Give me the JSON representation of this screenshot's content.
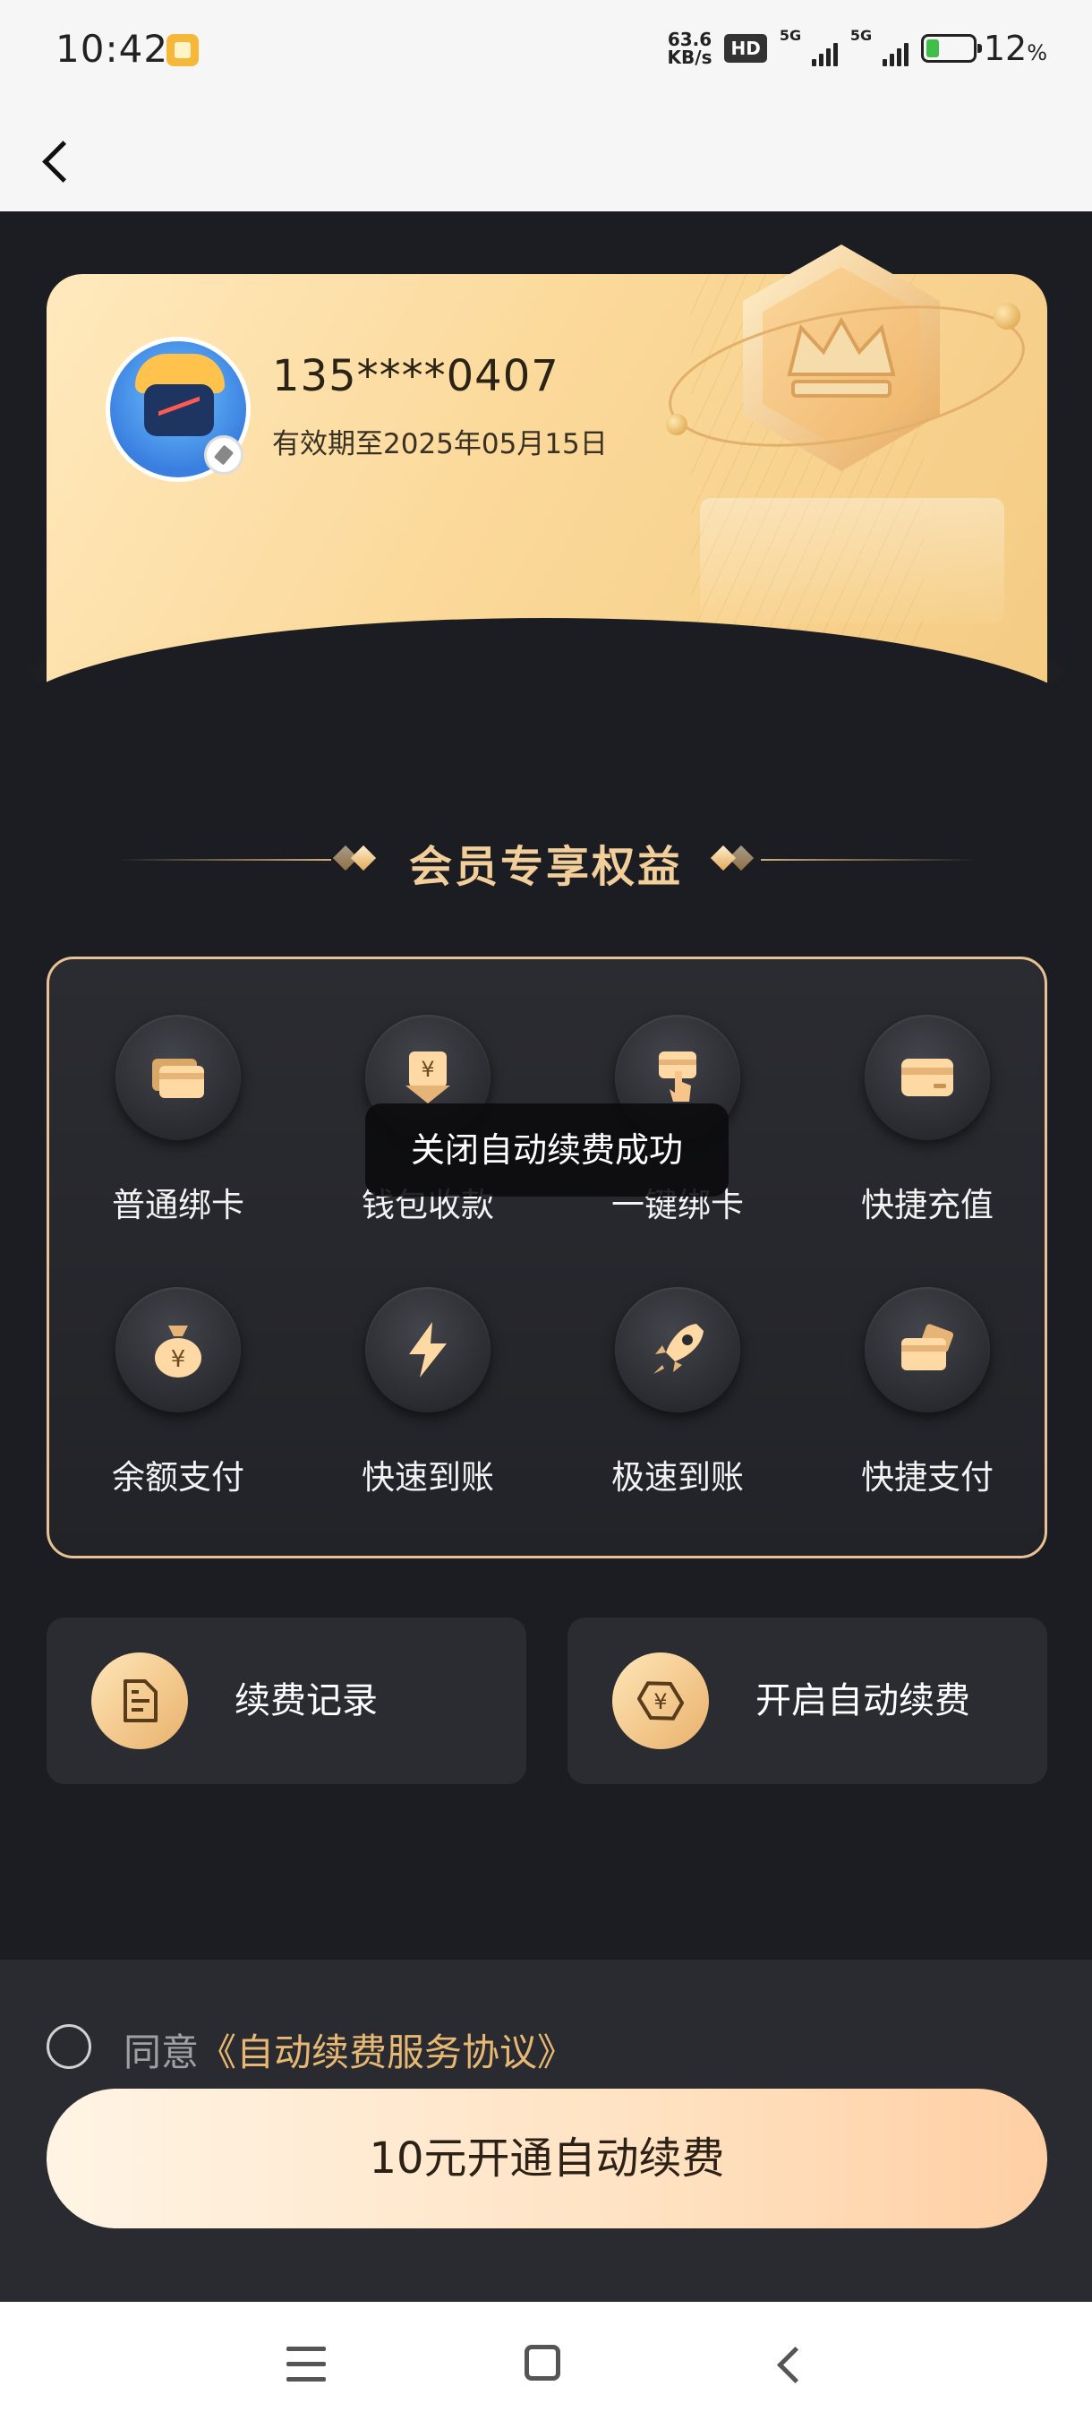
{
  "status_bar": {
    "time": "10:42",
    "net_speed_value": "63.6",
    "net_speed_unit": "KB/s",
    "hd_label": "HD",
    "signal_1_label": "5G",
    "signal_2_label": "5G",
    "battery_percent": "12",
    "battery_unit": "%"
  },
  "nav": {
    "back_icon": "chevron-left-icon"
  },
  "member_card": {
    "phone": "135****0407",
    "expiry": "有效期至2025年05月15日"
  },
  "section": {
    "title": "会员专享权益"
  },
  "benefits": [
    {
      "label": "普通绑卡",
      "icon": "cards-icon"
    },
    {
      "label": "钱包收款",
      "icon": "yuan-download-icon"
    },
    {
      "label": "一键绑卡",
      "icon": "tap-card-icon"
    },
    {
      "label": "快捷充值",
      "icon": "card-icon"
    },
    {
      "label": "余额支付",
      "icon": "money-bag-icon"
    },
    {
      "label": "快速到账",
      "icon": "lightning-icon"
    },
    {
      "label": "极速到账",
      "icon": "rocket-icon"
    },
    {
      "label": "快捷支付",
      "icon": "card-pay-icon"
    }
  ],
  "toast": {
    "message": "关闭自动续费成功"
  },
  "actions": [
    {
      "label": "续费记录",
      "icon": "document-icon"
    },
    {
      "label": "开启自动续费",
      "icon": "yuan-hexagon-icon"
    }
  ],
  "agreement": {
    "prefix": "同意",
    "link": "《自动续费服务协议》"
  },
  "cta": {
    "label": "10元开通自动续费"
  },
  "colors": {
    "accent_gold": "#f2cf9a",
    "link_gold": "#e6b873",
    "background": "#1c1d22",
    "panel_border": "#e8c295"
  }
}
